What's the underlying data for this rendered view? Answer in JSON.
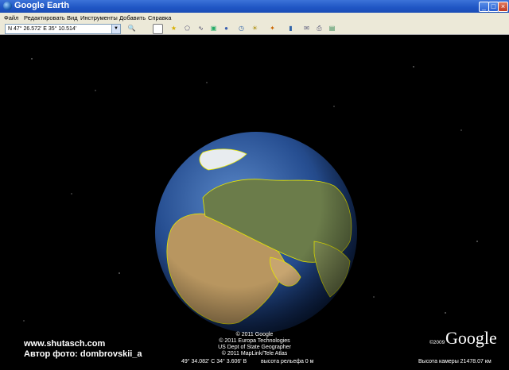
{
  "window": {
    "title": "Google Earth"
  },
  "menu": [
    "Файл",
    "Редактировать",
    "Вид",
    "Инструменты",
    "Добавить",
    "Справка"
  ],
  "search": {
    "value": "N 47° 26.572' E 35° 10.514'"
  },
  "toolbar_icons": [
    "search-go-icon",
    "sidebar-icon",
    "placemark-icon",
    "polygon-icon",
    "path-icon",
    "overlay-icon",
    "record-tour-icon",
    "historical-imagery-icon",
    "sunlight-icon",
    "switch-sky-icon",
    "ruler-icon",
    "email-icon",
    "print-icon",
    "view-in-maps-icon"
  ],
  "credits": [
    "© 2011 Google",
    "© 2011 Europa Technologies",
    "US Dept of State Geographer",
    "© 2011 MapLink/Tele Atlas"
  ],
  "status": {
    "coords": "49° 34.082' С   34° 3.606' В",
    "elevation": "высота рельефа   0 м",
    "eye_alt": "Высота камеры  21478.07 км"
  },
  "logo": {
    "text": "Google",
    "year": "©2009"
  },
  "watermark": {
    "line1": "www.shutasch.com",
    "line2": "Автор фото: dombrovskii_a"
  }
}
